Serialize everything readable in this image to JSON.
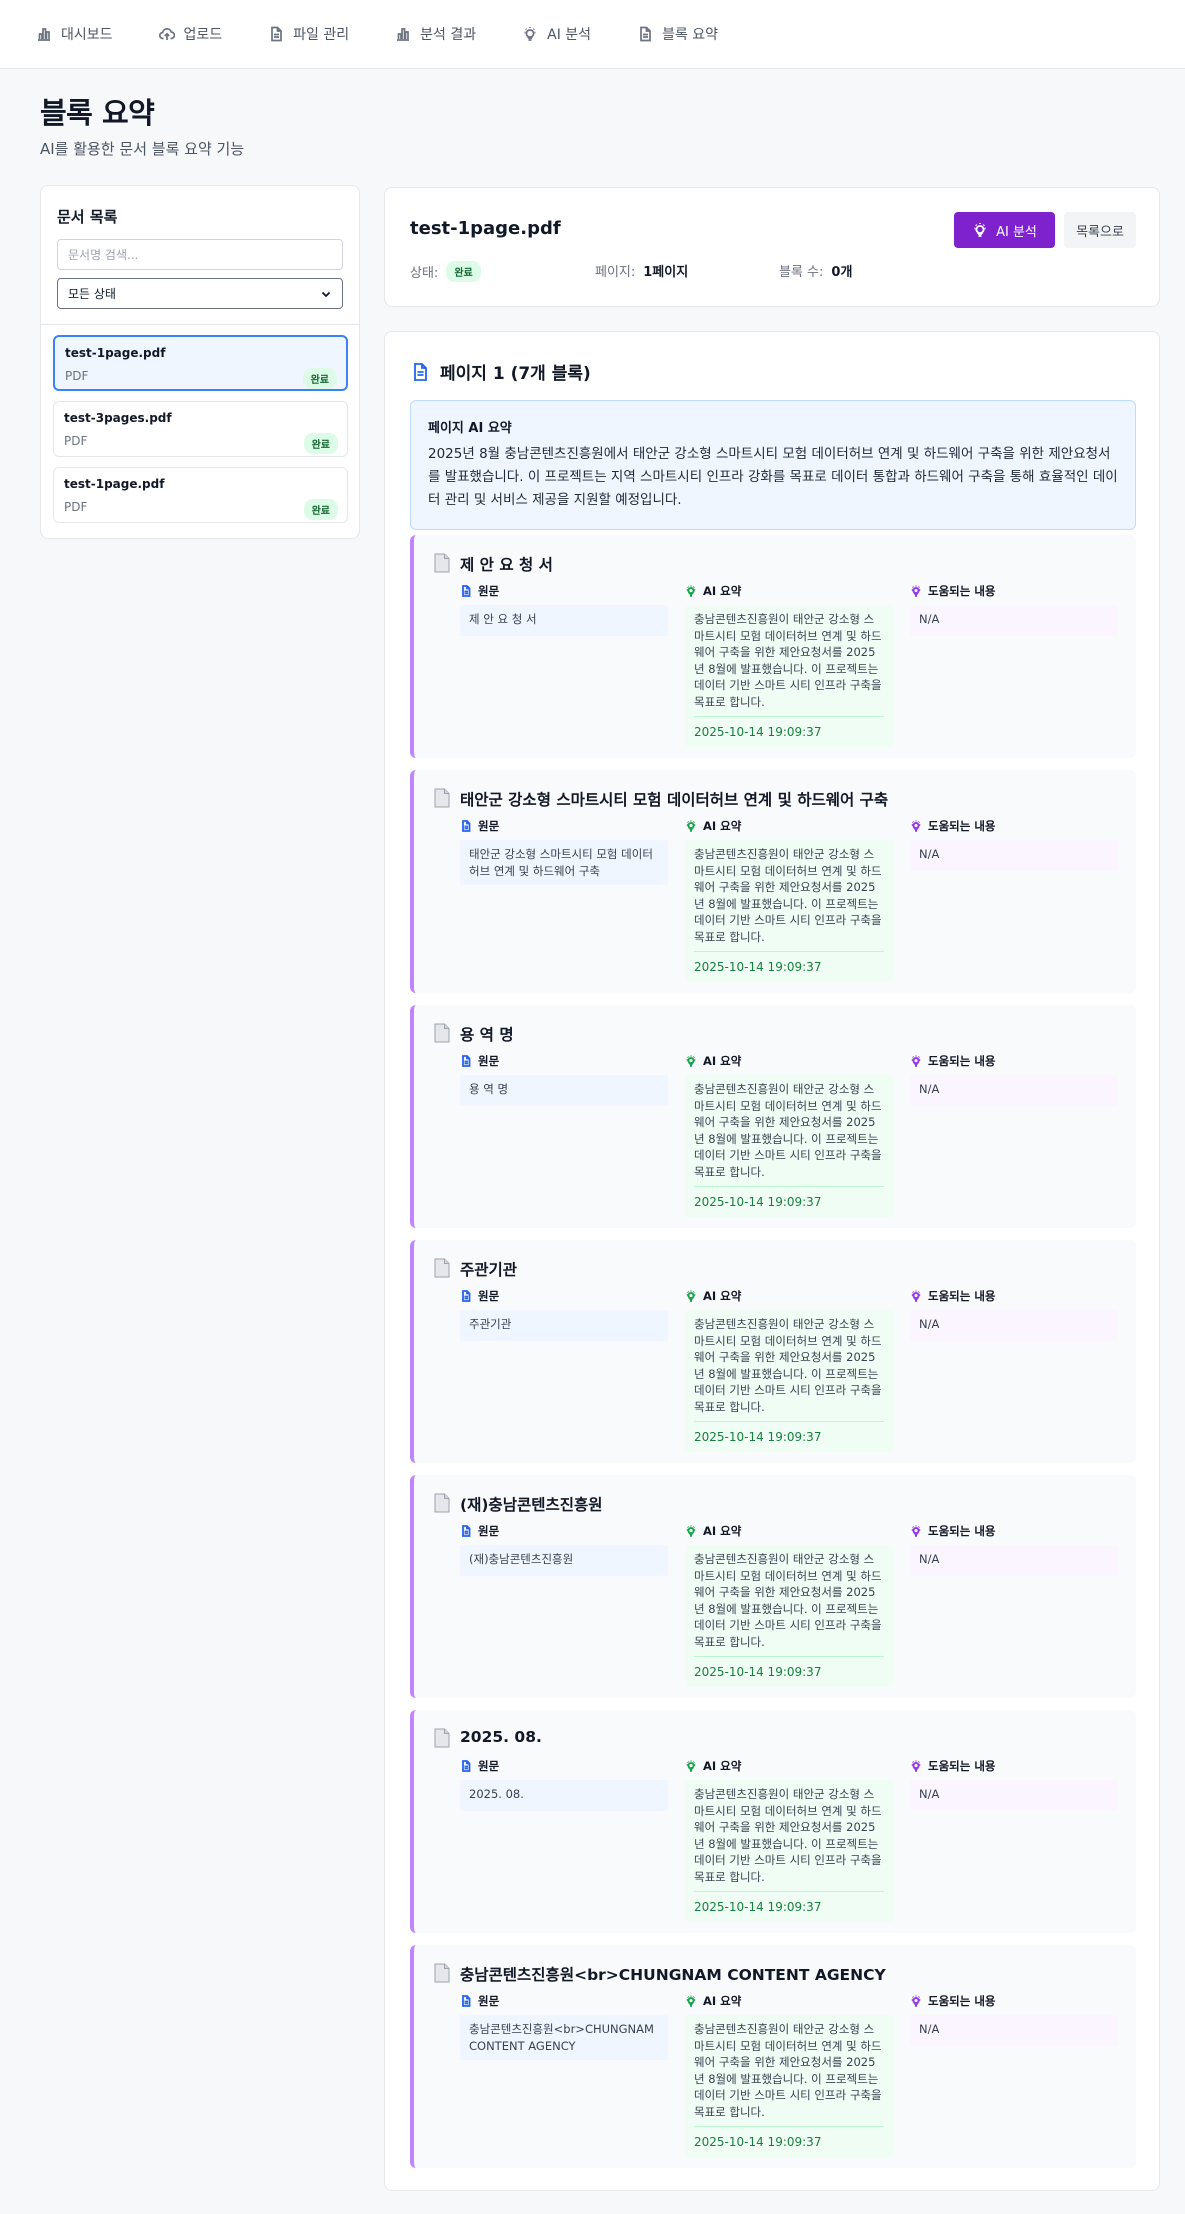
{
  "nav": [
    {
      "label": "대시보드",
      "icon": "bar-chart-icon"
    },
    {
      "label": "업로드",
      "icon": "cloud-upload-icon"
    },
    {
      "label": "파일 관리",
      "icon": "file-icon"
    },
    {
      "label": "분석 결과",
      "icon": "bar-chart-icon"
    },
    {
      "label": "AI 분석",
      "icon": "lightbulb-icon"
    },
    {
      "label": "블록 요약",
      "icon": "file-icon"
    }
  ],
  "page": {
    "title": "블록 요약",
    "subtitle": "AI를 활용한 문서 블록 요약 기능"
  },
  "sidebar": {
    "title": "문서 목록",
    "search_placeholder": "문서명 검색...",
    "filter_value": "모든 상태",
    "documents": [
      {
        "name": "test-1page.pdf",
        "type": "PDF",
        "status": "완료",
        "selected": true
      },
      {
        "name": "test-3pages.pdf",
        "type": "PDF",
        "status": "완료",
        "selected": false
      },
      {
        "name": "test-1page.pdf",
        "type": "PDF",
        "status": "완료",
        "selected": false
      }
    ]
  },
  "detail": {
    "filename": "test-1page.pdf",
    "ai_button": "AI 분석",
    "back_button": "목록으로",
    "status_label": "상태:",
    "status_value": "완료",
    "pages_label": "페이지:",
    "pages_value": "1페이지",
    "blocks_label": "블록 수:",
    "blocks_value": "0개"
  },
  "page_section": {
    "heading": "페이지 1 (7개 블록)",
    "summary_title": "페이지 AI 요약",
    "summary_text": "2025년 8월 충남콘텐츠진흥원에서 태안군 강소형 스마트시티 모험 데이터허브 연계 및 하드웨어 구축을 위한 제안요청서를 발표했습니다. 이 프로젝트는 지역 스마트시티 인프라 강화를 목표로 데이터 통합과 하드웨어 구축을 통해 효율적인 데이터 관리 및 서비스 제공을 지원할 예정입니다."
  },
  "labels": {
    "original": "원문",
    "ai_summary": "AI 요약",
    "helpful": "도움되는 내용"
  },
  "blocks": [
    {
      "title": "제 안 요 청 서",
      "original": "제 안 요 청 서",
      "ai_summary": "충남콘텐츠진흥원이 태안군 강소형 스마트시티 모험 데이터허브 연계 및 하드웨어 구축을 위한 제안요청서를 2025년 8월에 발표했습니다. 이 프로젝트는 데이터 기반 스마트 시티 인프라 구축을 목표로 합니다.",
      "date": "2025-10-14 19:09:37",
      "helpful": "N/A"
    },
    {
      "title": "태안군 강소형 스마트시티 모험 데이터허브 연계 및 하드웨어 구축",
      "original": "태안군 강소형 스마트시티 모험 데이터허브 연계 및 하드웨어 구축",
      "ai_summary": "충남콘텐츠진흥원이 태안군 강소형 스마트시티 모험 데이터허브 연계 및 하드웨어 구축을 위한 제안요청서를 2025년 8월에 발표했습니다. 이 프로젝트는 데이터 기반 스마트 시티 인프라 구축을 목표로 합니다.",
      "date": "2025-10-14 19:09:37",
      "helpful": "N/A"
    },
    {
      "title": "용 역 명",
      "original": "용 역 명",
      "ai_summary": "충남콘텐츠진흥원이 태안군 강소형 스마트시티 모험 데이터허브 연계 및 하드웨어 구축을 위한 제안요청서를 2025년 8월에 발표했습니다. 이 프로젝트는 데이터 기반 스마트 시티 인프라 구축을 목표로 합니다.",
      "date": "2025-10-14 19:09:37",
      "helpful": "N/A"
    },
    {
      "title": "주관기관",
      "original": "주관기관",
      "ai_summary": "충남콘텐츠진흥원이 태안군 강소형 스마트시티 모험 데이터허브 연계 및 하드웨어 구축을 위한 제안요청서를 2025년 8월에 발표했습니다. 이 프로젝트는 데이터 기반 스마트 시티 인프라 구축을 목표로 합니다.",
      "date": "2025-10-14 19:09:37",
      "helpful": "N/A"
    },
    {
      "title": "(재)충남콘텐츠진흥원",
      "original": "(재)충남콘텐츠진흥원",
      "ai_summary": "충남콘텐츠진흥원이 태안군 강소형 스마트시티 모험 데이터허브 연계 및 하드웨어 구축을 위한 제안요청서를 2025년 8월에 발표했습니다. 이 프로젝트는 데이터 기반 스마트 시티 인프라 구축을 목표로 합니다.",
      "date": "2025-10-14 19:09:37",
      "helpful": "N/A"
    },
    {
      "title": "2025. 08.",
      "original": "2025. 08.",
      "ai_summary": "충남콘텐츠진흥원이 태안군 강소형 스마트시티 모험 데이터허브 연계 및 하드웨어 구축을 위한 제안요청서를 2025년 8월에 발표했습니다. 이 프로젝트는 데이터 기반 스마트 시티 인프라 구축을 목표로 합니다.",
      "date": "2025-10-14 19:09:37",
      "helpful": "N/A"
    },
    {
      "title": "충남콘텐츠진흥원<br>CHUNGNAM CONTENT AGENCY",
      "original": "충남콘텐츠진흥원<br>CHUNGNAM CONTENT AGENCY",
      "ai_summary": "충남콘텐츠진흥원이 태안군 강소형 스마트시티 모험 데이터허브 연계 및 하드웨어 구축을 위한 제안요청서를 2025년 8월에 발표했습니다. 이 프로젝트는 데이터 기반 스마트 시티 인프라 구축을 목표로 합니다.",
      "date": "2025-10-14 19:09:37",
      "helpful": "N/A"
    }
  ],
  "colors": {
    "accent": "#7e22ce",
    "block_border": "#c084fc",
    "selected_border": "#3b82f6",
    "status_bg": "#dcfce7",
    "date_text": "#15803d"
  }
}
